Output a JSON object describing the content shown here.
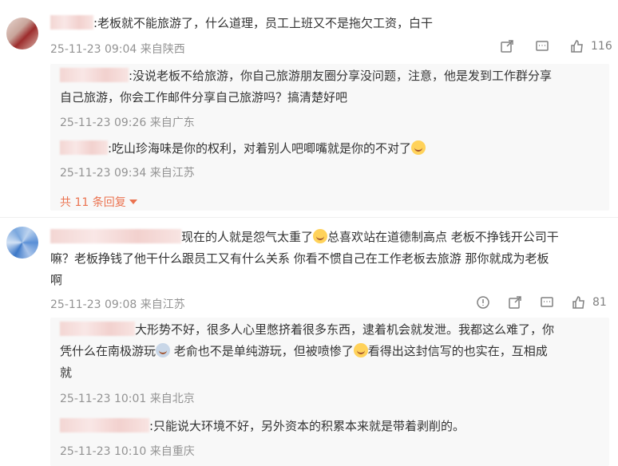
{
  "comments": [
    {
      "text": ":老板就不能旅游了，什么道理，员工上班又不是拖欠工资，白干",
      "time": "25-11-23 09:04",
      "location": "来自陕西",
      "likes": "116",
      "replies": [
        {
          "text_line1": ":没说老板不给旅游，你自己旅游朋友圈分享没问题，注意，他是发到工作群分享",
          "text_line2": "自己旅游，你会工作邮件分享自己旅游吗？搞清楚好吧",
          "time": "25-11-23 09:26",
          "location": "来自广东"
        },
        {
          "text": ":吃山珍海味是你的权利，对着别人吧唧嘴就是你的不对了",
          "time": "25-11-23 09:34",
          "location": "来自江苏"
        }
      ],
      "more_replies": "共 11 条回复"
    },
    {
      "text_a": "现在的人就是怨气太重了",
      "text_b": "总喜欢站在道德制高点 老板不挣钱开公司干",
      "text_line2": "嘛？老板挣钱了他干什么跟员工又有什么关系 你看不惯自己在工作老板去旅游 那你就成为老板",
      "text_line3": "啊",
      "time": "25-11-23 09:08",
      "location": "来自江苏",
      "likes": "81",
      "replies": [
        {
          "text_line1": "大形势不好，很多人心里憋挤着很多东西，逮着机会就发泄。我都这么难了，你",
          "text_line2a": "凭什么在南极游玩",
          "text_line2b": " 老俞也不是单纯游玩，但被喷惨了",
          "text_line2c": "看得出这封信写的也实在，互相成",
          "text_line3": "就",
          "time": "25-11-23 10:01",
          "location": "来自北京"
        },
        {
          "text": ":只能说大环境不好，另外资本的积累本来就是带着剥削的。",
          "time": "25-11-23 10:10",
          "location": "来自重庆"
        }
      ]
    }
  ],
  "colors": {
    "accent": "#eb7350",
    "meta": "#939393",
    "text": "#333333"
  },
  "icons": [
    "share-icon",
    "comment-icon",
    "like-icon",
    "report-icon",
    "caret-down-icon"
  ]
}
